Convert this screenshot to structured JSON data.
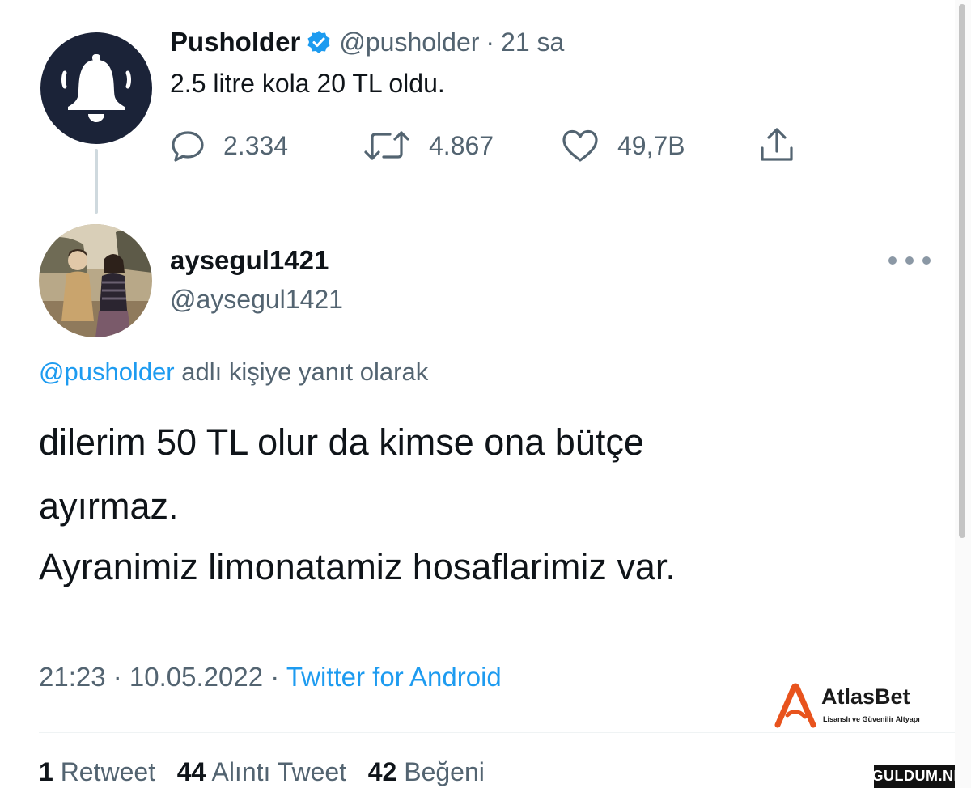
{
  "parent_tweet": {
    "display_name": "Pusholder",
    "handle": "@pusholder",
    "separator": "·",
    "time_ago": "21 sa",
    "text": "2.5 litre kola 20 TL oldu.",
    "replies": "2.334",
    "retweets": "4.867",
    "likes": "49,7B",
    "avatar_icon": "bell-icon"
  },
  "reply_tweet": {
    "display_name": "aysegul1421",
    "handle": "@aysegul1421",
    "reply_context": {
      "mention": "@pusholder",
      "suffix": " adlı kişiye yanıt olarak"
    },
    "body_lines": [
      "dilerim 50 TL olur da kimse ona bütçe",
      "ayırmaz.",
      "Ayranimiz limonatamiz hosaflarimiz var."
    ],
    "time": "21:23",
    "separator": " · ",
    "date": "10.05.2022",
    "source": "Twitter for Android",
    "stats": {
      "retweet_count": "1",
      "retweet_label": "Retweet",
      "quote_count": "44",
      "quote_label": "Alıntı Tweet",
      "like_count": "42",
      "like_label": "Beğeni"
    }
  },
  "watermark": {
    "brand": "AtlasBet",
    "tagline": "Lisanslı ve Güvenilir Altyapı",
    "site": "GULDUM.NET"
  },
  "colors": {
    "text": "#0f1419",
    "secondary": "#536471",
    "accent": "#1d9bf0",
    "avatar_bg": "#1b2338",
    "logo_orange": "#e8531d"
  }
}
